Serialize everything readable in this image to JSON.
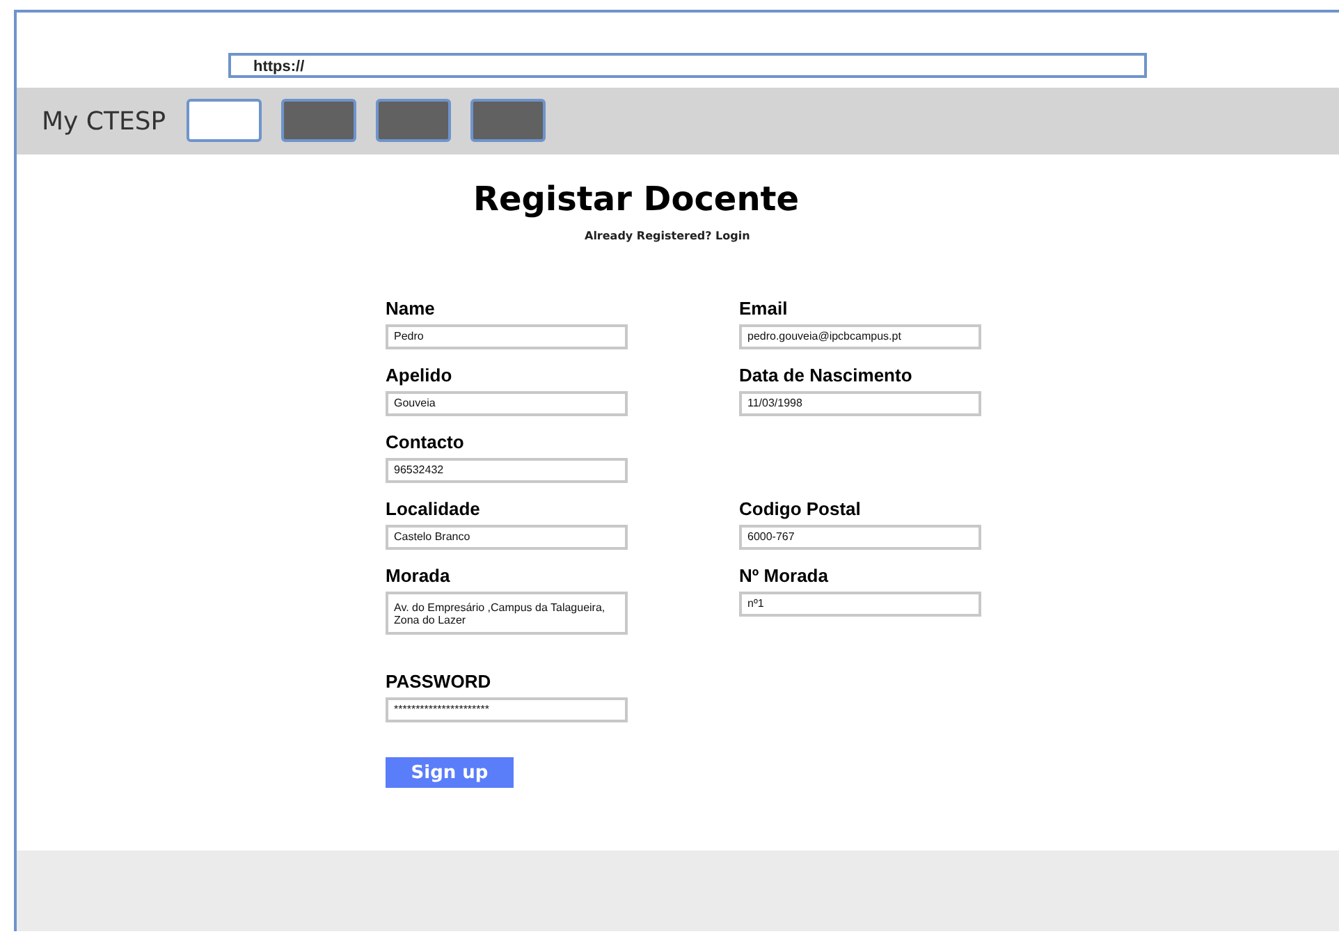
{
  "address_bar": {
    "value": "https://"
  },
  "nav": {
    "brand": "My CTESP",
    "tabs": [
      {
        "selected": true
      },
      {
        "selected": false
      },
      {
        "selected": false
      },
      {
        "selected": false
      }
    ]
  },
  "title": "Registar Docente",
  "login_prompt": "Already Registered? Login",
  "form": {
    "rows": [
      {
        "left": {
          "label": "Name",
          "value": "Pedro",
          "kind": "text"
        },
        "right": {
          "label": "Email",
          "value": "pedro.gouveia@ipcbcampus.pt",
          "kind": "text"
        }
      },
      {
        "left": {
          "label": "Apelido",
          "value": "Gouveia",
          "kind": "text"
        },
        "right": {
          "label": "Data de Nascimento",
          "value": "11/03/1998",
          "kind": "text"
        }
      },
      {
        "left": {
          "label": "Contacto",
          "value": "96532432",
          "kind": "text"
        }
      },
      {
        "left": {
          "label": "Localidade",
          "value": "Castelo Branco",
          "kind": "text"
        },
        "right": {
          "label": "Codigo Postal",
          "value": "6000-767",
          "kind": "text"
        }
      },
      {
        "left": {
          "label": "Morada",
          "value": "Av. do Empresário ,Campus da Talagueira, Zona do Lazer",
          "kind": "textarea"
        },
        "right": {
          "label": "Nº Morada",
          "value": "nº1",
          "kind": "text"
        }
      },
      {
        "left": {
          "label": "PASSWORD",
          "value": "**********************",
          "kind": "text"
        }
      }
    ]
  },
  "submit": "Sign up"
}
